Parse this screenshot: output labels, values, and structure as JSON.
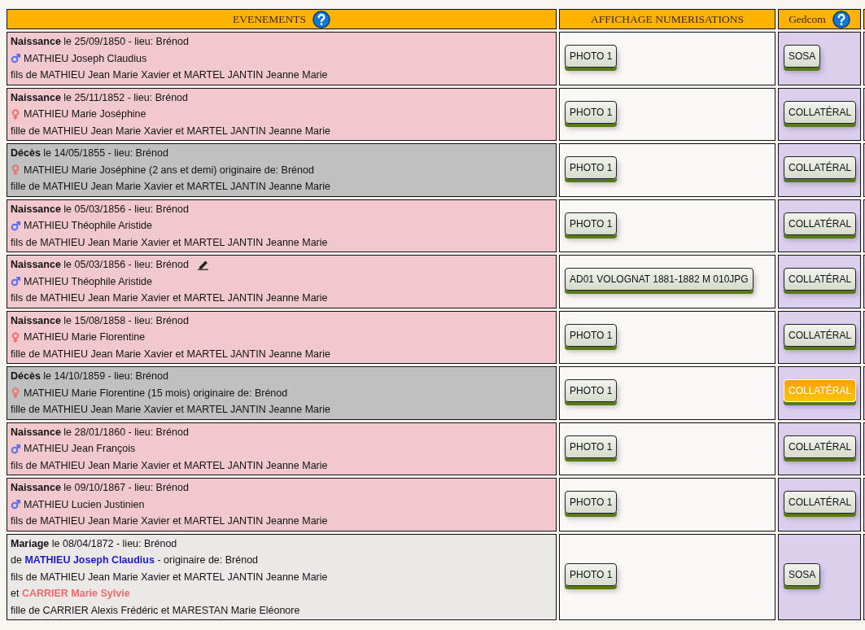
{
  "header": {
    "events": "EVENEMENTS",
    "scans": "AFFICHAGE NUMERISATIONS",
    "gedcom": "Gedcom"
  },
  "rows": [
    {
      "kind": "naissance",
      "annotated": false,
      "lines": [
        {
          "text": "**Naissance** le 25/09/1850 - lieu: Brénod"
        },
        {
          "text": "MATHIEU Joseph Claudius",
          "kind": "person",
          "male": true
        },
        {
          "text": "fils de MATHIEU Jean Marie Xavier et MARTEL JANTIN Jeanne Marie"
        }
      ],
      "scan": "PHOTO 1",
      "gedcom": {
        "label": "SOSA",
        "selected": false
      }
    },
    {
      "kind": "naissance",
      "annotated": false,
      "lines": [
        {
          "text": "**Naissance** le 25/11/1852 - lieu: Brénod"
        },
        {
          "text": "MATHIEU Marie Joséphine",
          "kind": "person",
          "male": false
        },
        {
          "text": "fille de MATHIEU Jean Marie Xavier et MARTEL JANTIN Jeanne Marie"
        }
      ],
      "scan": "PHOTO 1",
      "gedcom": {
        "label": "COLLATÉRAL",
        "selected": false
      }
    },
    {
      "kind": "deces",
      "annotated": false,
      "lines": [
        {
          "text": "**Décès** le 14/05/1855 - lieu: Brénod"
        },
        {
          "text": "MATHIEU Marie Joséphine (2 ans et demi) originaire de: Brénod",
          "kind": "person",
          "male": false
        },
        {
          "text": "fille de MATHIEU Jean Marie Xavier et MARTEL JANTIN Jeanne Marie"
        }
      ],
      "scan": "PHOTO 1",
      "gedcom": {
        "label": "COLLATÉRAL",
        "selected": false
      }
    },
    {
      "kind": "naissance",
      "annotated": false,
      "lines": [
        {
          "text": "**Naissance** le 05/03/1856 - lieu: Brénod"
        },
        {
          "text": "MATHIEU Théophile Aristide",
          "kind": "person",
          "male": true
        },
        {
          "text": "fils de MATHIEU Jean Marie Xavier et MARTEL JANTIN Jeanne Marie"
        }
      ],
      "scan": "PHOTO 1",
      "gedcom": {
        "label": "COLLATÉRAL",
        "selected": false
      }
    },
    {
      "kind": "naissance",
      "annotated": true,
      "lines": [
        {
          "text": "**Naissance** le 05/03/1856 - lieu: Brénod"
        },
        {
          "text": "MATHIEU Théophile Aristide",
          "kind": "person",
          "male": true
        },
        {
          "text": "fils de MATHIEU Jean Marie Xavier et MARTEL JANTIN Jeanne Marie"
        }
      ],
      "scan": "AD01 VOLOGNAT 1881-1882 M 010JPG",
      "gedcom": {
        "label": "COLLATÉRAL",
        "selected": false
      }
    },
    {
      "kind": "naissance",
      "annotated": false,
      "lines": [
        {
          "text": "**Naissance** le 15/08/1858 - lieu: Brénod"
        },
        {
          "text": "MATHIEU Marie Florentine",
          "kind": "person",
          "male": false
        },
        {
          "text": "fille de MATHIEU Jean Marie Xavier et MARTEL JANTIN Jeanne Marie"
        }
      ],
      "scan": "PHOTO 1",
      "gedcom": {
        "label": "COLLATÉRAL",
        "selected": false
      }
    },
    {
      "kind": "deces",
      "annotated": false,
      "lines": [
        {
          "text": "**Décès** le 14/10/1859 - lieu: Brénod"
        },
        {
          "text": "MATHIEU Marie Florentine (15 mois) originaire de: Brénod",
          "kind": "person",
          "male": false
        },
        {
          "text": "fille de MATHIEU Jean Marie Xavier et MARTEL JANTIN Jeanne Marie"
        }
      ],
      "scan": "PHOTO 1",
      "gedcom": {
        "label": "COLLATÉRAL",
        "selected": true
      }
    },
    {
      "kind": "naissance",
      "annotated": false,
      "lines": [
        {
          "text": "**Naissance** le 28/01/1860 - lieu: Brénod"
        },
        {
          "text": "MATHIEU Jean François",
          "kind": "person",
          "male": true
        },
        {
          "text": "fils de MATHIEU Jean Marie Xavier et MARTEL JANTIN Jeanne Marie"
        }
      ],
      "scan": "PHOTO 1",
      "gedcom": {
        "label": "COLLATÉRAL",
        "selected": false
      }
    },
    {
      "kind": "naissance",
      "annotated": false,
      "lines": [
        {
          "text": "**Naissance** le 09/10/1867 - lieu: Brénod"
        },
        {
          "text": "MATHIEU Lucien Justinien",
          "kind": "person",
          "male": true
        },
        {
          "text": "fils de MATHIEU Jean Marie Xavier et MARTEL JANTIN Jeanne Marie"
        }
      ],
      "scan": "PHOTO 1",
      "gedcom": {
        "label": "COLLATÉRAL",
        "selected": false
      }
    },
    {
      "kind": "mariage",
      "annotated": false,
      "lines": [
        {
          "text": "**Mariage** le 08/04/1872 - lieu: Brénod"
        },
        {
          "text": "de **MATHIEU Joseph Claudius** - originaire de: Brénod",
          "kind": "spouse",
          "male": true
        },
        {
          "text": "fils de MATHIEU Jean Marie Xavier et MARTEL JANTIN Jeanne Marie"
        },
        {
          "text": "et **CARRIER Marie Sylvie**",
          "kind": "spouse",
          "male": false
        },
        {
          "text": "fille de CARRIER Alexis Frédéric et MARESTAN Marie Eléonore"
        }
      ],
      "scan": "PHOTO 1",
      "gedcom": {
        "label": "SOSA",
        "selected": false
      }
    }
  ]
}
